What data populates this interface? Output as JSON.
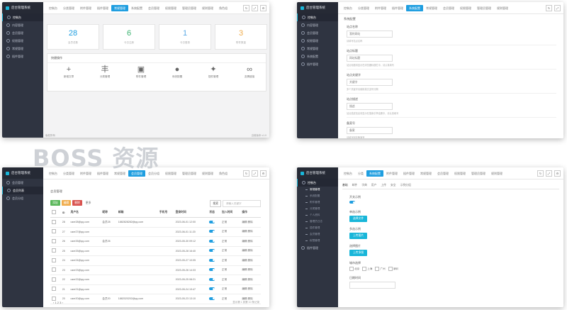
{
  "watermark": "BOSS 资源",
  "shot1": {
    "logo": "后台管理系统",
    "sidebar": [
      "控制台",
      "内容管理",
      "会员管理",
      "权限管理",
      "常规管理",
      "插件管理"
    ],
    "tabs": [
      "控制台",
      "分类管理",
      "附件管理",
      "插件管理",
      "常规管理",
      "系统配置",
      "会员管理",
      "权限管理",
      "管理员管理",
      "规则管理",
      "角色组"
    ],
    "active_tab": 4,
    "stats": [
      {
        "num": "28",
        "label": "会员总数",
        "color": "#1f9ee0"
      },
      {
        "num": "6",
        "label": "今日注册",
        "color": "#3cb371"
      },
      {
        "num": "1",
        "label": "今日登录",
        "color": "#5aa9e6"
      },
      {
        "num": "3",
        "label": "附件数量",
        "color": "#f0ad4e"
      }
    ],
    "quick_title": "快捷操作",
    "quick": [
      {
        "glyph": "+",
        "label": "新增文章"
      },
      {
        "glyph": "丰",
        "label": "分类管理"
      },
      {
        "glyph": "▣",
        "label": "附件管理"
      },
      {
        "glyph": "●",
        "label": "系统配置"
      },
      {
        "glyph": "✦",
        "label": "插件管理"
      },
      {
        "glyph": "∞",
        "label": "友情链接"
      }
    ],
    "footer_left": "版权所有",
    "footer_right": "当前版本 v1.0"
  },
  "shot2": {
    "logo": "后台管理系统",
    "sidebar": [
      "控制台",
      "内容管理",
      "会员管理",
      "权限管理",
      "常规管理",
      "系统配置",
      "插件管理"
    ],
    "tabs": [
      "控制台",
      "分类管理",
      "附件管理",
      "插件管理",
      "系统配置",
      "常规管理",
      "会员管理",
      "权限管理",
      "管理员管理",
      "规则管理"
    ],
    "active_tab": 4,
    "panel_title": "系统配置",
    "fields": [
      {
        "label": "站点名称",
        "value": "我的网站",
        "hint": "请填写站点名称"
      },
      {
        "label": "站点标题",
        "value": "网站标题",
        "hint": "站点标题将显示在浏览器标题栏中，请认真填写"
      },
      {
        "label": "站点关键字",
        "value": "关键字",
        "hint": "多个关键字请使用英文逗号分隔"
      },
      {
        "label": "站点描述",
        "value": "描述",
        "hint": "站点描述信息将显示在搜索引擎结果中，请认真填写"
      },
      {
        "label": "备案号",
        "value": "备案",
        "hint": "请填写网站备案号"
      },
      {
        "label": "版权信息",
        "value": "版权",
        "hint": "版权信息将显示在网站底部"
      }
    ]
  },
  "shot3": {
    "logo": "后台管理系统",
    "sidebar": [
      "会员管理",
      "会员列表",
      "会员分组"
    ],
    "tabs": [
      "控制台",
      "分类管理",
      "附件管理",
      "插件管理",
      "常规管理",
      "会员管理",
      "会员分组",
      "权限管理",
      "管理员管理",
      "规则管理",
      "角色组"
    ],
    "active_tab": 5,
    "panel_title": "会员管理",
    "buttons": [
      {
        "label": "添加",
        "color": "#5cb85c"
      },
      {
        "label": "编辑",
        "color": "#f0ad4e"
      },
      {
        "label": "删除",
        "color": "#d9534f"
      }
    ],
    "extra": "更多",
    "search_btn": "搜索",
    "search_placeholder": "请输入关键字",
    "columns": [
      "",
      "ID",
      "用户名",
      "昵称",
      "邮箱",
      "手机号",
      "登录时间",
      "状态",
      "加入时间",
      "操作"
    ],
    "rows": [
      [
        "",
        "28",
        "user28@qq.com",
        "会员28",
        "1882828282@qq.com",
        "",
        "2023-06-01 12:00",
        "",
        "正常",
        "编辑 删除"
      ],
      [
        "",
        "27",
        "user27@qq.com",
        "",
        "",
        "",
        "2023-06-01 11:20",
        "",
        "正常",
        "编辑 删除"
      ],
      [
        "",
        "26",
        "user26@qq.com",
        "会员26",
        "",
        "",
        "2023-05-30 09:12",
        "",
        "正常",
        "编辑 删除"
      ],
      [
        "",
        "25",
        "user25@qq.com",
        "",
        "",
        "",
        "2023-05-28 16:40",
        "",
        "正常",
        "编辑 删除"
      ],
      [
        "",
        "24",
        "user24@qq.com",
        "",
        "",
        "",
        "2023-05-27 10:05",
        "",
        "正常",
        "编辑 删除"
      ],
      [
        "",
        "23",
        "user23@qq.com",
        "",
        "",
        "",
        "2023-05-26 14:33",
        "",
        "正常",
        "编辑 删除"
      ],
      [
        "",
        "22",
        "user22@qq.com",
        "",
        "",
        "",
        "2023-05-25 08:21",
        "",
        "正常",
        "编辑 删除"
      ],
      [
        "",
        "21",
        "user21@qq.com",
        "",
        "",
        "",
        "2023-05-24 19:47",
        "",
        "正常",
        "编辑 删除"
      ],
      [
        "",
        "20",
        "user20@qq.com",
        "会员20",
        "1882020202@qq.com",
        "",
        "2023-05-23 13:10",
        "",
        "正常",
        "编辑 删除"
      ]
    ],
    "pager_left": "‹ 1 2 3 ›",
    "pager_right": "显示第 1 到第 10 条记录"
  },
  "shot4": {
    "logo": "后台管理系统",
    "sidebar_top": "控制台",
    "sidebar": [
      "常规管理",
      "系统配置",
      "附件管理",
      "分类管理",
      "个人资料",
      "管理员日志",
      "插件管理",
      "会员管理",
      "权限管理"
    ],
    "sidebar_bottom": "插件管理",
    "tabs": [
      "控制台",
      "分类",
      "系统配置",
      "附件管理",
      "插件管理",
      "常规管理",
      "会员管理",
      "权限管理",
      "管理员管理",
      "规则管理"
    ],
    "active_tab": 2,
    "subtabs": [
      "基础",
      "邮件",
      "字典",
      "用户",
      "上传",
      "安全",
      "示例分组"
    ],
    "form": [
      {
        "label": "开关示例",
        "kind": "switch"
      },
      {
        "label": "单选示例",
        "kind": "button",
        "btn": "选择文件"
      },
      {
        "label": "多选示例",
        "kind": "button",
        "btn": "上传图片"
      },
      {
        "label": "选择图片",
        "kind": "button",
        "btn": "上传多图"
      },
      {
        "label": "城市选择",
        "kind": "checks",
        "options": [
          "北京",
          "上海",
          "广州",
          "深圳"
        ]
      },
      {
        "label": "日期时间",
        "kind": "input"
      }
    ]
  }
}
